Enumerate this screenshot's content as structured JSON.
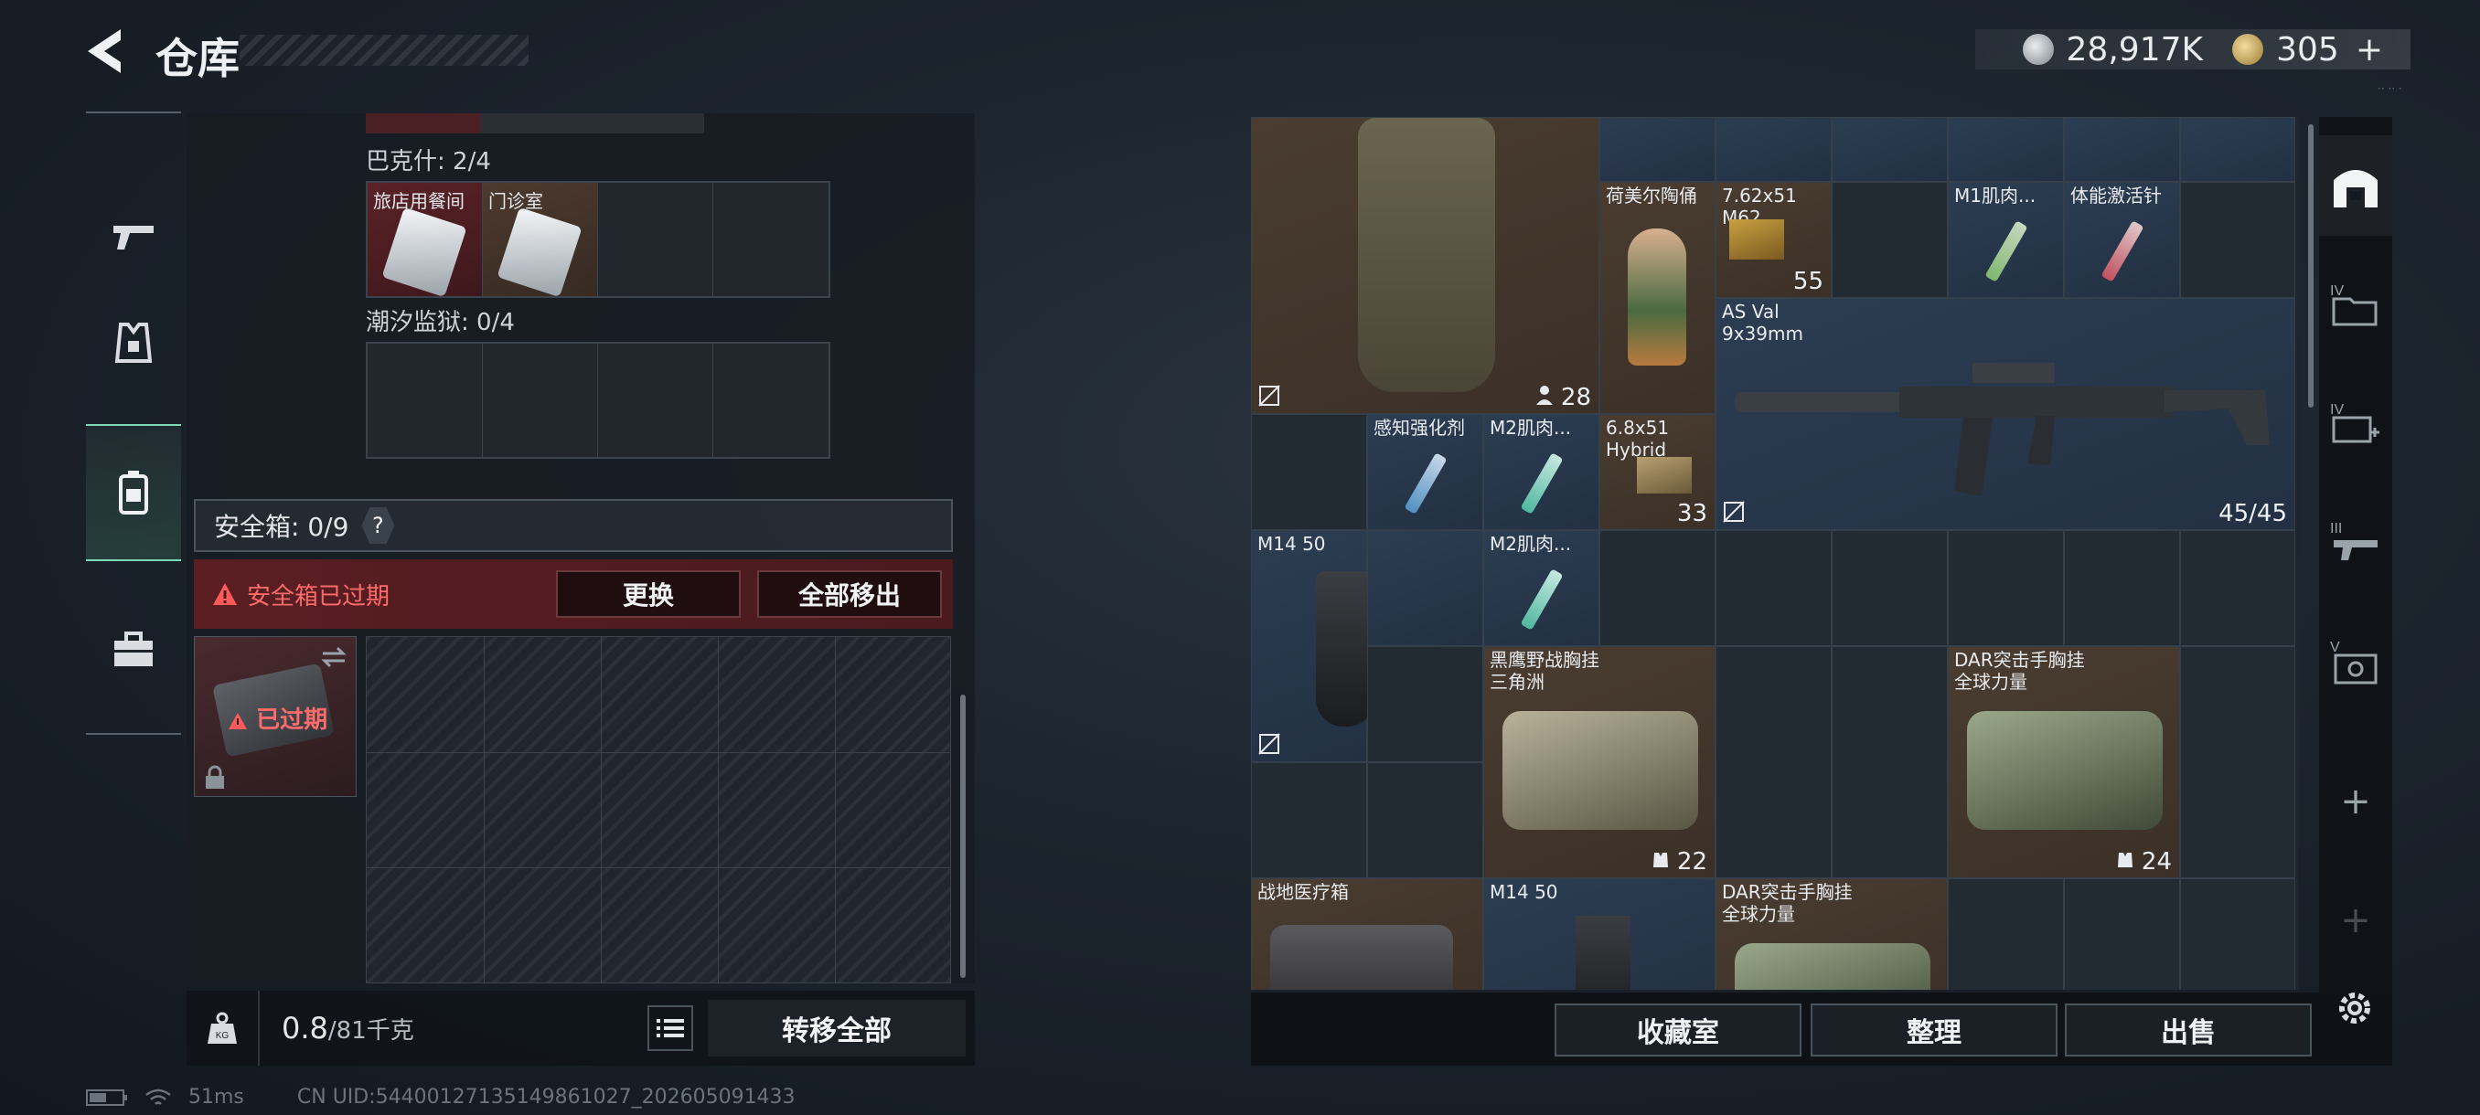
{
  "header": {
    "title": "仓库",
    "currency_silver": "28,917K",
    "currency_gold": "305",
    "currency_plus": "+"
  },
  "left": {
    "section1_label": "巴克什: 2/4",
    "keycards": [
      {
        "label": "旅店用餐间",
        "color": "red"
      },
      {
        "label": "门诊室",
        "color": "brown"
      }
    ],
    "section2_label": "潮汐监狱: 0/4",
    "safebox_label": "安全箱: 0/9",
    "help_label": "?",
    "warning_text": "安全箱已过期",
    "replace_label": "更换",
    "move_all_label": "全部移出",
    "expired_label": "已过期",
    "weight_value": "0.8",
    "weight_max": "/81千克",
    "transfer_all_label": "转移全部"
  },
  "status": {
    "ping": "51ms",
    "uid": "CN UID:5440012713514986102​7_202605091433"
  },
  "stash_items": [
    {
      "id": "backpack",
      "name": "",
      "count": "28",
      "count_icon": "person-icon"
    },
    {
      "id": "hummel",
      "name": "荷美尔陶俑",
      "count": ""
    },
    {
      "id": "ammo762",
      "name": "7.62x51\nM62",
      "count": "55"
    },
    {
      "id": "m1",
      "name": "M1肌肉...",
      "count": ""
    },
    {
      "id": "stamina",
      "name": "体能激活针",
      "count": ""
    },
    {
      "id": "asval",
      "name": "AS Val\n9x39mm",
      "count": "45/45"
    },
    {
      "id": "perception",
      "name": "感知强化剂",
      "count": ""
    },
    {
      "id": "m2a",
      "name": "M2肌肉...",
      "count": ""
    },
    {
      "id": "ammo68",
      "name": "6.8x51\nHybrid",
      "count": "33"
    },
    {
      "id": "m14a",
      "name": "M14 50",
      "count": ""
    },
    {
      "id": "m2b",
      "name": "M2肌肉...",
      "count": ""
    },
    {
      "id": "rig1",
      "name": "黑鹰野战胸挂\n三角洲",
      "count": "22"
    },
    {
      "id": "rig2",
      "name": "DAR突击手胸挂\n全球力量",
      "count": "24"
    },
    {
      "id": "medkit",
      "name": "战地医疗箱",
      "count": ""
    },
    {
      "id": "m14b",
      "name": "M14 50",
      "count": ""
    },
    {
      "id": "rig3",
      "name": "DAR突击手胸挂\n全球力量",
      "count": ""
    }
  ],
  "footer": {
    "collection_label": "收藏室",
    "sort_label": "整理",
    "sell_label": "出售"
  },
  "right_rail": {
    "tier4_a": "IV",
    "tier4_b": "IV",
    "tier3": "III",
    "tier5": "V",
    "plus_a": "+",
    "plus_b": "+"
  }
}
